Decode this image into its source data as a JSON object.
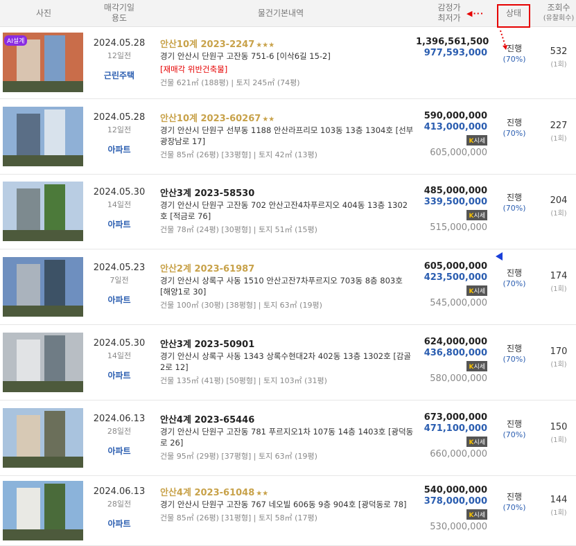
{
  "header": {
    "photo": "사진",
    "date_use_1": "매각기일",
    "date_use_2": "용도",
    "info": "물건기본내역",
    "price_1": "감정가",
    "price_2": "최저가",
    "status": "상태",
    "views_1": "조회수",
    "views_2": "(유찰회수)"
  },
  "annotations": {
    "arrow_left": "◀···"
  },
  "rows": [
    {
      "badge": "AI설계",
      "date": "2024.05.28",
      "ago": "12일전",
      "use": "근린주택",
      "case": "안산10계 2023-2247",
      "stars": "★★★",
      "highlight": true,
      "addr": "경기 안산시 단원구 고잔동 751-6 [이삭6길 15-2]",
      "note": "[재매각   위반건축물]",
      "area": "건물 621㎡ (188평)  |  토지 245㎡ (74평)",
      "appraisal": "1,396,561,500",
      "minimum": "977,593,000",
      "market_label": "",
      "market": "",
      "status": "진행",
      "pct": "(70%)",
      "views": "532",
      "fail": "(1회)"
    },
    {
      "badge": "",
      "date": "2024.05.28",
      "ago": "12일전",
      "use": "아파트",
      "case": "안산10계 2023-60267",
      "stars": "★★",
      "highlight": true,
      "addr": "경기 안산시 단원구 선부동 1188 안산라프리모 103동 13층 1304호 [선부광장남로 17]",
      "note": "",
      "area": "건물 85㎡ (26평) [33평형]  |  토지 42㎡ (13평)",
      "appraisal": "590,000,000",
      "minimum": "413,000,000",
      "market_label": "시세",
      "market": "605,000,000",
      "status": "진행",
      "pct": "(70%)",
      "views": "227",
      "fail": "(1회)"
    },
    {
      "badge": "",
      "date": "2024.05.30",
      "ago": "14일전",
      "use": "아파트",
      "case": "안산3계 2023-58530",
      "stars": "",
      "highlight": false,
      "addr": "경기 안산시 단원구 고잔동 702 안산고잔4차푸르지오 404동 13층 1302호 [적금로 76]",
      "note": "",
      "area": "건물 78㎡ (24평) [30평형]  |  토지 51㎡ (15평)",
      "appraisal": "485,000,000",
      "minimum": "339,500,000",
      "market_label": "시세",
      "market": "515,000,000",
      "status": "진행",
      "pct": "(70%)",
      "views": "204",
      "fail": "(1회)"
    },
    {
      "badge": "",
      "date": "2024.05.23",
      "ago": "7일전",
      "use": "아파트",
      "case": "안산2계 2023-61987",
      "stars": "",
      "highlight": true,
      "addr": "경기 안산시 상록구 사동 1510 안산고잔7차푸르지오 703동 8층 803호 [해양1로 30]",
      "note": "",
      "area": "건물 100㎡ (30평) [38평형]  |  토지 63㎡ (19평)",
      "appraisal": "605,000,000",
      "minimum": "423,500,000",
      "market_label": "시세",
      "market": "545,000,000",
      "status": "진행",
      "pct": "(70%)",
      "views": "174",
      "fail": "(1회)"
    },
    {
      "badge": "",
      "date": "2024.05.30",
      "ago": "14일전",
      "use": "아파트",
      "case": "안산3계 2023-50901",
      "stars": "",
      "highlight": false,
      "addr": "경기 안산시 상록구 사동 1343 상록수현대2차 402동 13층 1302호 [감골2로 12]",
      "note": "",
      "area": "건물 135㎡ (41평) [50평형]  |  토지 103㎡ (31평)",
      "appraisal": "624,000,000",
      "minimum": "436,800,000",
      "market_label": "시세",
      "market": "580,000,000",
      "status": "진행",
      "pct": "(70%)",
      "views": "170",
      "fail": "(1회)"
    },
    {
      "badge": "",
      "date": "2024.06.13",
      "ago": "28일전",
      "use": "아파트",
      "case": "안산4계 2023-65446",
      "stars": "",
      "highlight": false,
      "addr": "경기 안산시 단원구 고잔동 781 푸르지오1차 107동 14층 1403호 [광덕동로 26]",
      "note": "",
      "area": "건물 95㎡ (29평) [37평형]  |  토지 63㎡ (19평)",
      "appraisal": "673,000,000",
      "minimum": "471,100,000",
      "market_label": "시세",
      "market": "660,000,000",
      "status": "진행",
      "pct": "(70%)",
      "views": "150",
      "fail": "(1회)"
    },
    {
      "badge": "",
      "date": "2024.06.13",
      "ago": "28일전",
      "use": "아파트",
      "case": "안산4계 2023-61048",
      "stars": "★★",
      "highlight": true,
      "addr": "경기 안산시 단원구 고잔동 767 네오빌 606동 9층 904호 [광덕동로 78]",
      "note": "",
      "area": "건물 85㎡ (26평) [31평형]  |  토지 58㎡ (17평)",
      "appraisal": "540,000,000",
      "minimum": "378,000,000",
      "market_label": "시세",
      "market": "530,000,000",
      "status": "진행",
      "pct": "(70%)",
      "views": "144",
      "fail": "(1회)"
    }
  ]
}
